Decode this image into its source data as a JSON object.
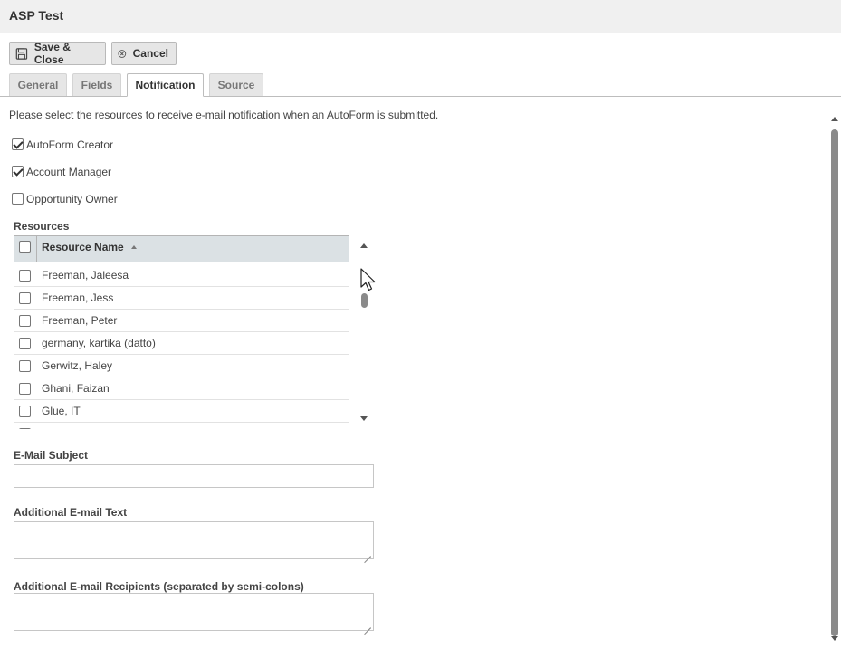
{
  "window": {
    "title": "ASP Test"
  },
  "toolbar": {
    "save_close_label": "Save & Close",
    "cancel_label": "Cancel"
  },
  "tabs": [
    {
      "label": "General",
      "active": false
    },
    {
      "label": "Fields",
      "active": false
    },
    {
      "label": "Notification",
      "active": true
    },
    {
      "label": "Source",
      "active": false
    }
  ],
  "notification": {
    "intro": "Please select the resources to receive e-mail notification when an AutoForm is submitted.",
    "options": [
      {
        "label": "AutoForm Creator",
        "checked": true
      },
      {
        "label": "Account Manager",
        "checked": true
      },
      {
        "label": "Opportunity Owner",
        "checked": false
      }
    ],
    "resources_label": "Resources",
    "grid": {
      "column_header": "Resource Name",
      "sort": "ascending",
      "rows": [
        {
          "name": "Freeman, Jaleesa",
          "checked": false
        },
        {
          "name": "Freeman, Jess",
          "checked": false
        },
        {
          "name": "Freeman, Peter",
          "checked": false
        },
        {
          "name": "germany, kartika (datto)",
          "checked": false
        },
        {
          "name": "Gerwitz, Haley",
          "checked": false
        },
        {
          "name": "Ghani, Faizan",
          "checked": false
        },
        {
          "name": "Glue, IT",
          "checked": false
        }
      ]
    },
    "email_subject": {
      "label": "E-Mail Subject",
      "value": ""
    },
    "additional_text": {
      "label": "Additional E-mail Text",
      "value": ""
    },
    "additional_recipients": {
      "label": "Additional E-mail Recipients (separated by semi-colons)",
      "value": ""
    }
  },
  "icons": {
    "save": "floppy-disk-icon",
    "cancel": "cancel-circle-icon",
    "sort": "sort-ascending-icon"
  },
  "colors": {
    "titlebar_bg": "#f0f0f0",
    "grid_header_bg": "#dbe1e4",
    "button_bg": "#e6e6e6"
  }
}
